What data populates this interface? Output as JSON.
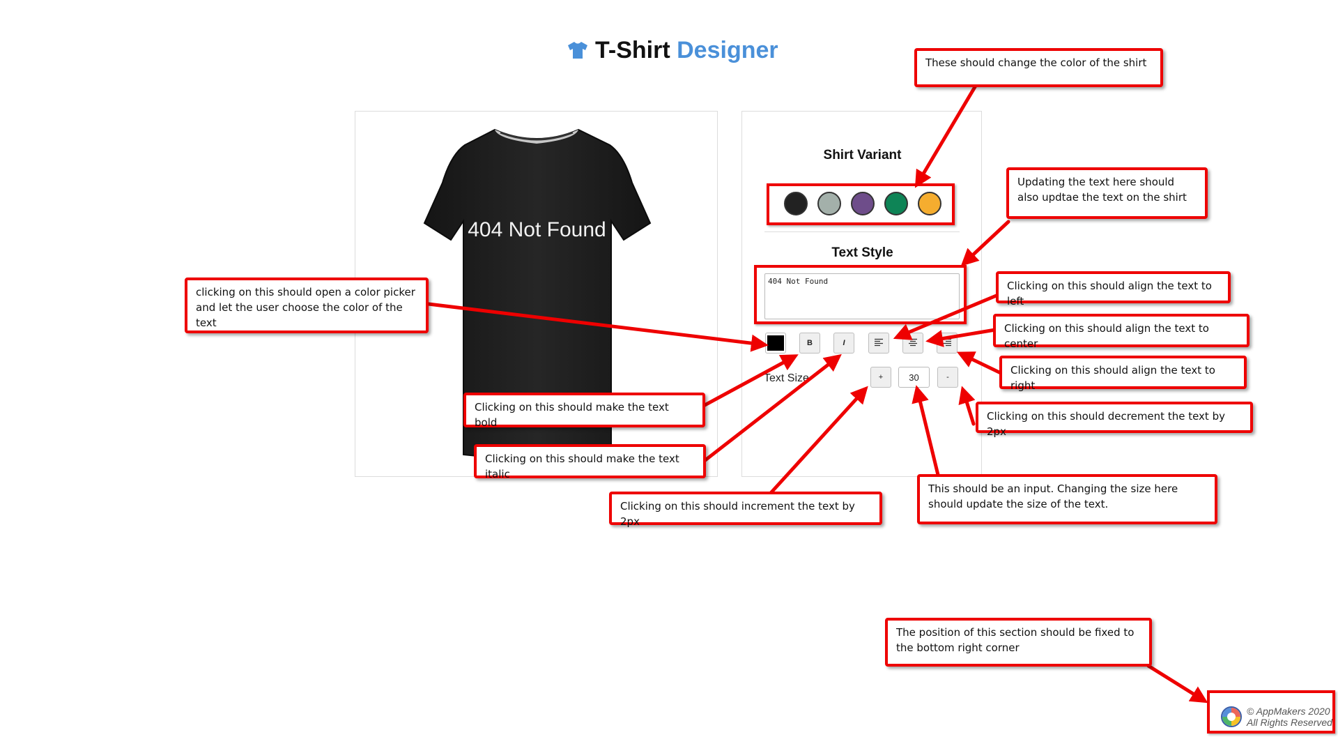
{
  "header": {
    "title": "T-Shirt",
    "title_accent": "Designer",
    "icon": "tshirt-icon",
    "accent_color": "#4a90d9"
  },
  "preview": {
    "shirt_color": "#1f1f1f",
    "text": "404 Not Found",
    "text_color": "#f2f2f2"
  },
  "controls": {
    "shirt_variant_title": "Shirt Variant",
    "swatches": [
      {
        "color": "#222222",
        "name": "black"
      },
      {
        "color": "#a3b0aa",
        "name": "gray"
      },
      {
        "color": "#6e4d8a",
        "name": "purple"
      },
      {
        "color": "#0e8456",
        "name": "green"
      },
      {
        "color": "#f5ad2f",
        "name": "yellow"
      }
    ],
    "text_style_title": "Text Style",
    "text_value": "404 Not Found",
    "text_color": "#000000",
    "bold_label": "B",
    "italic_label": "I",
    "align_left_icon": "align-left-icon",
    "align_center_icon": "align-center-icon",
    "align_right_icon": "align-right-icon",
    "text_size_label": "Text Size",
    "increment_label": "+",
    "size_value": "30",
    "decrement_label": "-"
  },
  "annotations": {
    "shirt_color": "These should change the color of the shirt",
    "update_text": "Updating the text here should also updtae the text on the shirt",
    "color_picker": "clicking on this should open a color picker and let the user choose the color of the text",
    "align_left": "Clicking on this should align the text to left",
    "align_center": "Clicking on this should align the text to center",
    "align_right": "Clicking on this should align the text to right",
    "bold": "Clicking on this should make the text bold",
    "decrement": "Clicking on this should decrement the text by 2px",
    "italic": "Clicking on this should make the text italic",
    "increment": "Clicking on this should increment the text by 2px",
    "size_input": "This should be an input. Changing the size here should update the size of the text.",
    "footer_fixed": "The position of this section should be fixed to the bottom right corner"
  },
  "footer": {
    "line1": "© AppMakers 2020",
    "line2": "All Rights Reserved",
    "logo": "appmakers-logo-icon"
  }
}
